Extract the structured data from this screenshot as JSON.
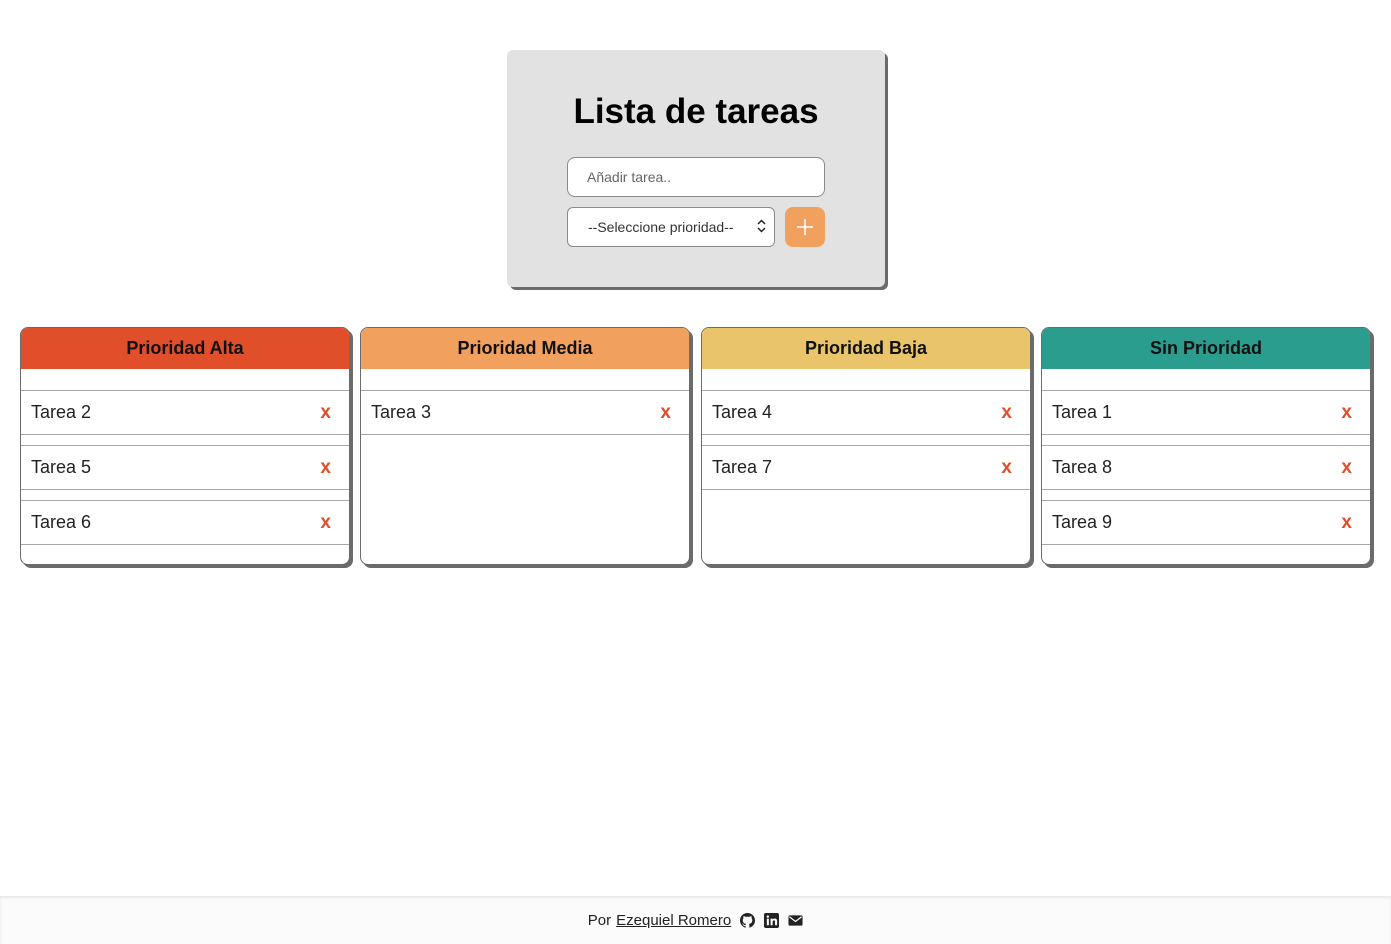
{
  "form": {
    "title": "Lista de tareas",
    "input_placeholder": "Añadir tarea..",
    "select_value": "--Seleccione prioridad--",
    "add_icon": "plus-icon",
    "add_button_color": "#f2a05e"
  },
  "columns": [
    {
      "title": "Prioridad Alta",
      "color": "#e04e2a",
      "tasks": [
        {
          "label": "Tarea 2",
          "delete": "x"
        },
        {
          "label": "Tarea 5",
          "delete": "x"
        },
        {
          "label": "Tarea 6",
          "delete": "x"
        }
      ]
    },
    {
      "title": "Prioridad Media",
      "color": "#f2a05e",
      "tasks": [
        {
          "label": "Tarea 3",
          "delete": "x"
        }
      ]
    },
    {
      "title": "Prioridad Baja",
      "color": "#e9c46a",
      "tasks": [
        {
          "label": "Tarea 4",
          "delete": "x"
        },
        {
          "label": "Tarea 7",
          "delete": "x"
        }
      ]
    },
    {
      "title": "Sin Prioridad",
      "color": "#2a9d8f",
      "tasks": [
        {
          "label": "Tarea 1",
          "delete": "x"
        },
        {
          "label": "Tarea 8",
          "delete": "x"
        },
        {
          "label": "Tarea 9",
          "delete": "x"
        }
      ]
    }
  ],
  "footer": {
    "prefix": "Por",
    "author": "Ezequiel Romero",
    "icons": [
      "github-icon",
      "linkedin-icon",
      "email-icon"
    ]
  }
}
